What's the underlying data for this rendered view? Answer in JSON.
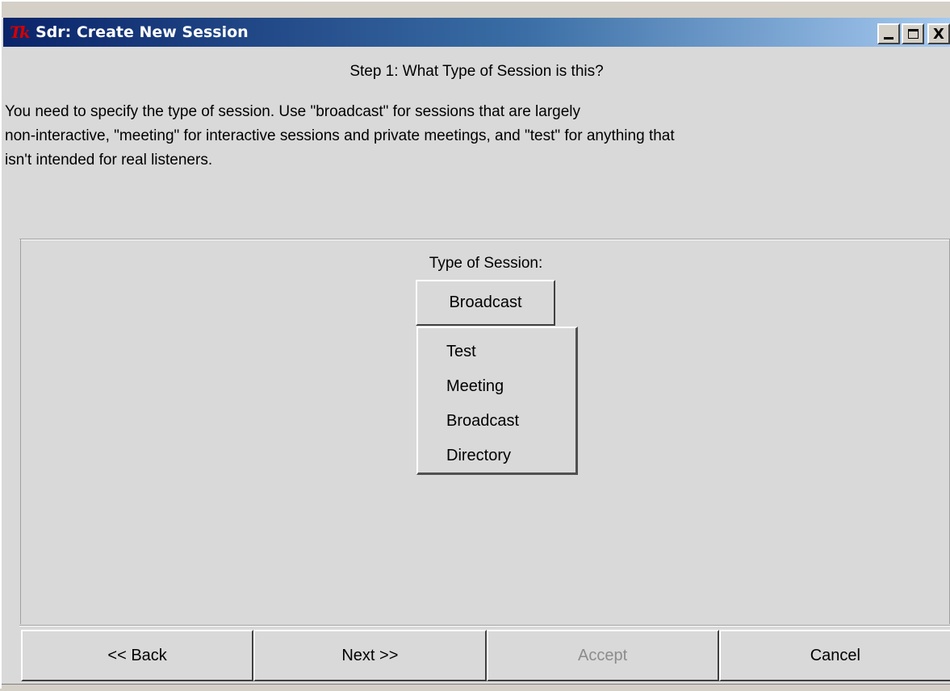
{
  "window": {
    "title": "Sdr: Create New Session",
    "logo_text": "Tk",
    "controls": {
      "minimize_icon": "minimize-icon",
      "maximize_icon": "maximize-icon",
      "close_label": "X"
    }
  },
  "step": {
    "title": "Step 1: What Type of Session is this?",
    "description_lines": [
      "You need to specify the type of session.  Use \"broadcast\" for sessions that are largely",
      "non-interactive, \"meeting\" for interactive sessions and private meetings, and \"test\" for anything that",
      "isn't intended for real listeners."
    ]
  },
  "session_type": {
    "label": "Type of Session:",
    "selected": "Broadcast",
    "options": [
      "Test",
      "Meeting",
      "Broadcast",
      "Directory"
    ]
  },
  "buttons": {
    "back": "<< Back",
    "next": "Next >>",
    "accept": "Accept",
    "cancel": "Cancel"
  },
  "colors": {
    "titlebar_start": "#0a246a",
    "titlebar_end": "#a6caf0",
    "window_bg": "#d9d9d9",
    "logo_red": "#d40000",
    "disabled_text": "#8c8c8c"
  }
}
